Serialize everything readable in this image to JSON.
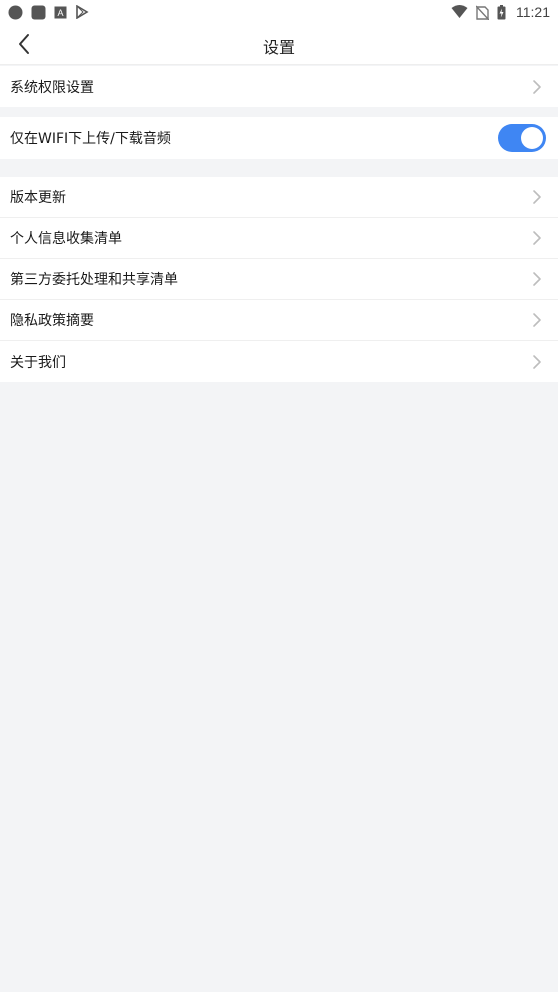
{
  "status_bar": {
    "time": "11:21",
    "icons_left": [
      "circle-notification-icon",
      "square-notification-icon",
      "text-app-icon",
      "play-store-icon"
    ],
    "icons_right": [
      "wifi-icon",
      "no-sim-icon",
      "battery-charging-icon"
    ]
  },
  "header": {
    "title": "设置",
    "back_icon": "chevron-left-icon"
  },
  "settings": {
    "permissions": {
      "label": "系统权限设置"
    },
    "wifi_only": {
      "label": "仅在WIFI下上传/下载音频",
      "enabled": true
    },
    "version_update": {
      "label": "版本更新"
    },
    "personal_info": {
      "label": "个人信息收集清单"
    },
    "third_party": {
      "label": "第三方委托处理和共享清单"
    },
    "privacy_summary": {
      "label": "隐私政策摘要"
    },
    "about_us": {
      "label": "关于我们"
    }
  },
  "colors": {
    "accent": "#3f86f3",
    "background": "#f3f4f6",
    "surface": "#ffffff",
    "chevron": "#bdbdbd"
  }
}
